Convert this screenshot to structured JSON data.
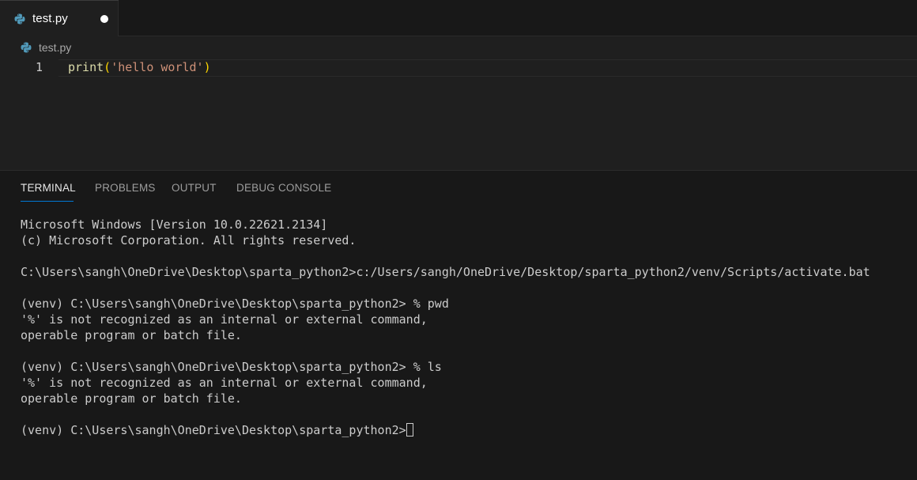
{
  "editor_tab": {
    "label": "test.py",
    "icon": "python-file-icon",
    "dirty": true
  },
  "breadcrumb": {
    "label": "test.py",
    "icon": "python-file-icon"
  },
  "editor": {
    "lines": [
      {
        "number": "1",
        "tokens": {
          "fn": "print",
          "open": "(",
          "str": "'hello world'",
          "close": ")"
        }
      }
    ]
  },
  "panel": {
    "tabs": [
      {
        "label": "TERMINAL",
        "active": true
      },
      {
        "label": "PROBLEMS",
        "active": false
      },
      {
        "label": "OUTPUT",
        "active": false
      },
      {
        "label": "DEBUG CONSOLE",
        "active": false
      }
    ]
  },
  "terminal": {
    "lines": [
      "Microsoft Windows [Version 10.0.22621.2134]",
      "(c) Microsoft Corporation. All rights reserved.",
      "",
      "C:\\Users\\sangh\\OneDrive\\Desktop\\sparta_python2>c:/Users/sangh/OneDrive/Desktop/sparta_python2/venv/Scripts/activate.bat",
      "",
      "(venv) C:\\Users\\sangh\\OneDrive\\Desktop\\sparta_python2> % pwd",
      "'%' is not recognized as an internal or external command,",
      "operable program or batch file.",
      "",
      "(venv) C:\\Users\\sangh\\OneDrive\\Desktop\\sparta_python2> % ls",
      "'%' is not recognized as an internal or external command,",
      "operable program or batch file.",
      ""
    ],
    "prompt": "(venv) C:\\Users\\sangh\\OneDrive\\Desktop\\sparta_python2>"
  },
  "colors": {
    "background": "#1e1e1e",
    "python_icon": "#519aba",
    "accent": "#0078d4"
  }
}
